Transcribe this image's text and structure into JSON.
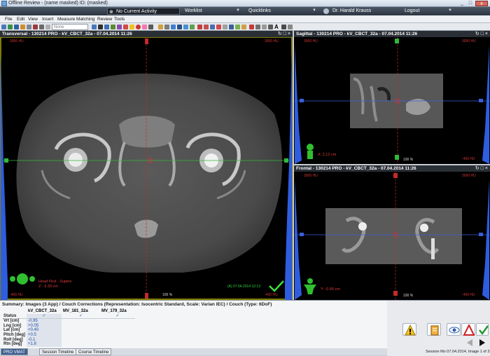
{
  "window": {
    "title": "Offline Review - (name masked) ID: (masked)",
    "min": "_",
    "max": "□",
    "close": "x"
  },
  "topbar": {
    "activity": "No Current Activity",
    "worklist": "Worklist",
    "quicklinks": "Quicklinks",
    "user": "Dr. Harald Krauss",
    "logout": "Logout",
    "search_glyph": "⊗",
    "arrow": "▼"
  },
  "menu": [
    "File",
    "Edit",
    "View",
    "Insert",
    "Measure",
    "Matching",
    "Review",
    "Tools"
  ],
  "toolbar": {
    "dropdown_value": "None",
    "text_tool": "A"
  },
  "viewers": {
    "transversal": {
      "title": "Transversal - 130214 PRO - kV_CBCT_32a - 07.04.2014 11:26",
      "hu_top_left": "3000 HU",
      "hu_top_right": "3000 HU",
      "hu_bottom_left": "-400 HU",
      "hu_bottom_right": "-400 HU",
      "orientation": "Head First - Supine",
      "coord": "Z: -3.33 cm",
      "scale": "100 %",
      "timestamp": "(A) 07.04.2014 12:13"
    },
    "sagittal": {
      "title": "Sagittal - 130214 PRO - kV_CBCT_32a - 07.04.2014 11:26",
      "hu_top_left": "3000 HU",
      "hu_top_right": "3000 HU",
      "hu_bottom_right": "-400 HU",
      "coord": "X: 2.12 cm",
      "scale": "100 %"
    },
    "frontal": {
      "title": "Frontal - 130214 PRO - kV_CBCT_32a - 07.04.2014 11:26",
      "hu_top_left": "3000 HU",
      "hu_top_right": "3000 HU",
      "hu_bottom_right": "-400 HU",
      "coord": "Y: -0.66 cm",
      "scale": "100 %"
    },
    "controls": "↻ □ ×"
  },
  "summary": {
    "heading": "Summary: Images (3 App) / Couch Corrections (Representation: Isocentric Standard, Scale: Varian IEC) / Couch (Type: 6DoF)",
    "columns": [
      "kV_CBCT_32a",
      "MV_181_32a",
      "MV_179_32a"
    ],
    "rows": [
      {
        "label": "Status",
        "values": [
          "✓",
          "✓",
          "✓"
        ]
      },
      {
        "label": "Vrt [cm]",
        "values": [
          "-0.95",
          "",
          ""
        ]
      },
      {
        "label": "Lng [cm]",
        "values": [
          "+0.05",
          "",
          ""
        ]
      },
      {
        "label": "Lat [cm]",
        "values": [
          "+0.40",
          "",
          ""
        ]
      },
      {
        "label": "Pitch [deg]",
        "values": [
          "+0.5",
          "",
          ""
        ]
      },
      {
        "label": "Roll [deg]",
        "values": [
          "-0.1",
          "",
          ""
        ]
      },
      {
        "label": "Rtn [deg]",
        "values": [
          "+1.8",
          "",
          ""
        ]
      }
    ]
  },
  "tabs": [
    "PRO VMAT",
    "Session Timeline",
    "Course Timeline"
  ],
  "session_status": "Session Mo 07.04.2014, Image 1 of 3",
  "colors": {
    "accent": "#3f5f8f",
    "hu_red": "#d23333",
    "overlay_green": "#35d23d",
    "viewer_bg": "#000000"
  }
}
